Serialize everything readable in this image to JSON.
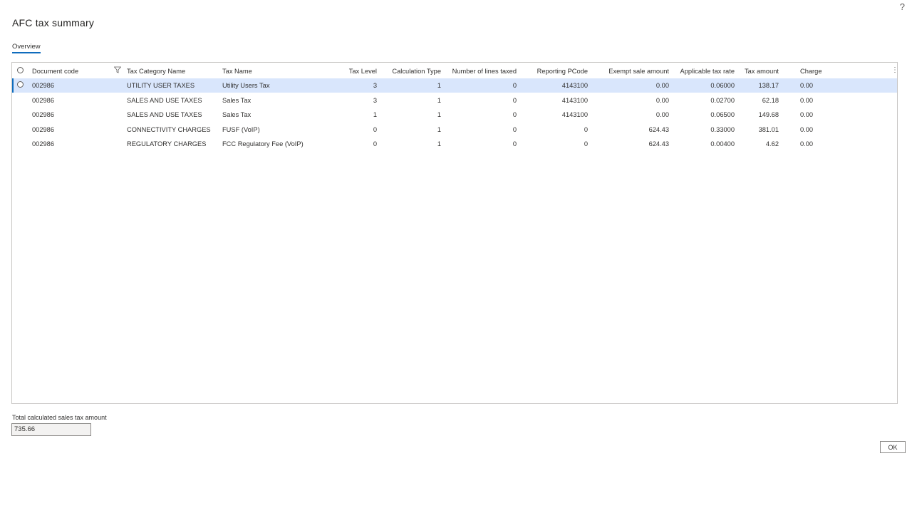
{
  "dialog": {
    "title": "AFC tax summary",
    "help_glyph": "?"
  },
  "tabs": [
    {
      "label": "Overview"
    }
  ],
  "grid": {
    "columns": [
      {
        "key": "document_code",
        "label": "Document code"
      },
      {
        "key": "tax_category_name",
        "label": "Tax Category Name"
      },
      {
        "key": "tax_name",
        "label": "Tax Name"
      },
      {
        "key": "tax_level",
        "label": "Tax Level"
      },
      {
        "key": "calculation_type",
        "label": "Calculation Type"
      },
      {
        "key": "number_of_lines_taxed",
        "label": "Number of lines taxed"
      },
      {
        "key": "reporting_pcode",
        "label": "Reporting PCode"
      },
      {
        "key": "exempt_sale_amount",
        "label": "Exempt sale amount"
      },
      {
        "key": "applicable_tax_rate",
        "label": "Applicable tax rate"
      },
      {
        "key": "tax_amount",
        "label": "Tax amount"
      },
      {
        "key": "charge",
        "label": "Charge"
      }
    ],
    "more_glyph": "⋮",
    "rows": [
      [
        "002986",
        "UTILITY USER TAXES",
        "Utility Users Tax",
        "3",
        "1",
        "0",
        "4143100",
        "0.00",
        "0.06000",
        "138.17",
        "0.00"
      ],
      [
        "002986",
        "SALES AND USE TAXES",
        "Sales Tax",
        "3",
        "1",
        "0",
        "4143100",
        "0.00",
        "0.02700",
        "62.18",
        "0.00"
      ],
      [
        "002986",
        "SALES AND USE TAXES",
        "Sales Tax",
        "1",
        "1",
        "0",
        "4143100",
        "0.00",
        "0.06500",
        "149.68",
        "0.00"
      ],
      [
        "002986",
        "CONNECTIVITY CHARGES",
        "FUSF (VoIP)",
        "0",
        "1",
        "0",
        "0",
        "624.43",
        "0.33000",
        "381.01",
        "0.00"
      ],
      [
        "002986",
        "REGULATORY CHARGES",
        "FCC Regulatory Fee (VoIP)",
        "0",
        "1",
        "0",
        "0",
        "624.43",
        "0.00400",
        "4.62",
        "0.00"
      ]
    ],
    "selected_row": 0
  },
  "footer": {
    "total_label": "Total calculated sales tax amount",
    "total_value": "735.66",
    "ok_label": "OK"
  },
  "colors": {
    "accent": "#0f6cbd",
    "selected_row": "#d9e6fc",
    "border": "#c8c6c4"
  }
}
